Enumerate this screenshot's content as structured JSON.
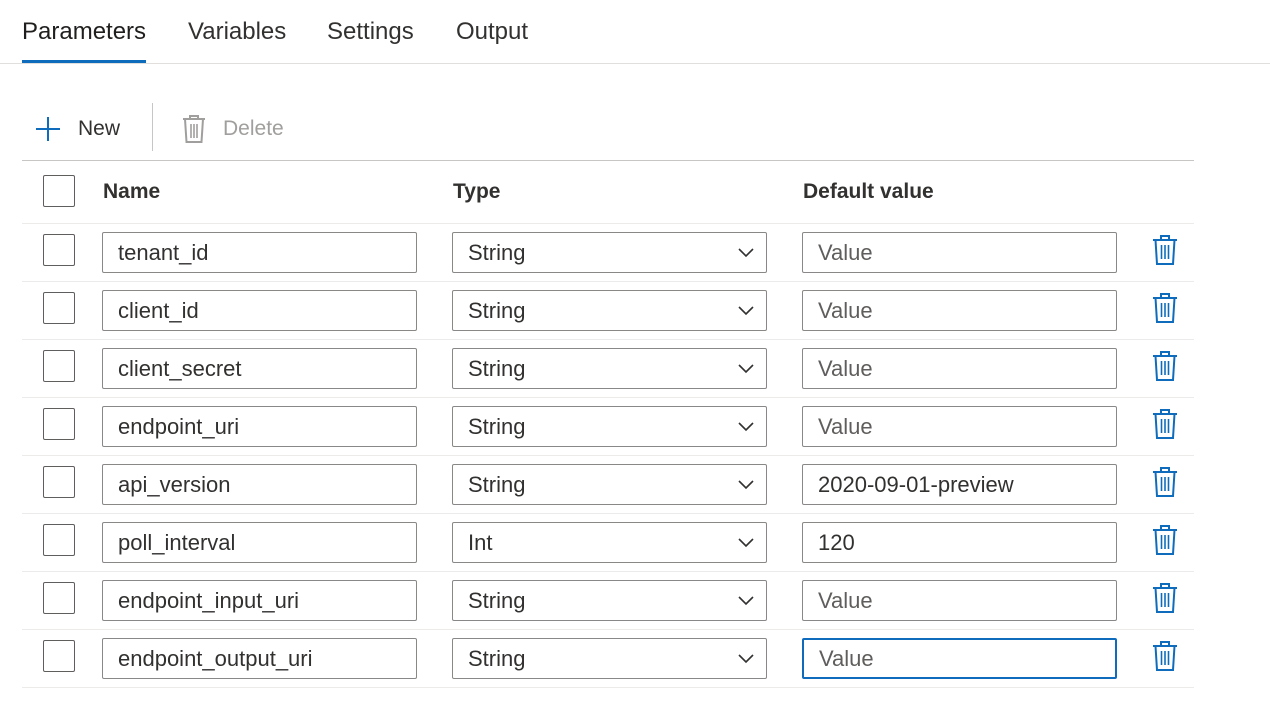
{
  "tabs": [
    "Parameters",
    "Variables",
    "Settings",
    "Output"
  ],
  "active_tab": "Parameters",
  "toolbar": {
    "new_label": "New",
    "delete_label": "Delete"
  },
  "columns": {
    "name": "Name",
    "type": "Type",
    "default_value": "Default value"
  },
  "default_value_placeholder": "Value",
  "rows": [
    {
      "name": "tenant_id",
      "type": "String",
      "default_value": ""
    },
    {
      "name": "client_id",
      "type": "String",
      "default_value": ""
    },
    {
      "name": "client_secret",
      "type": "String",
      "default_value": ""
    },
    {
      "name": "endpoint_uri",
      "type": "String",
      "default_value": ""
    },
    {
      "name": "api_version",
      "type": "String",
      "default_value": "2020-09-01-preview"
    },
    {
      "name": "poll_interval",
      "type": "Int",
      "default_value": "120"
    },
    {
      "name": "endpoint_input_uri",
      "type": "String",
      "default_value": ""
    },
    {
      "name": "endpoint_output_uri",
      "type": "String",
      "default_value": ""
    }
  ],
  "colors": {
    "accent": "#0f6cbd",
    "text": "#323130",
    "disabled": "#a19f9d",
    "border": "#8a8886"
  }
}
